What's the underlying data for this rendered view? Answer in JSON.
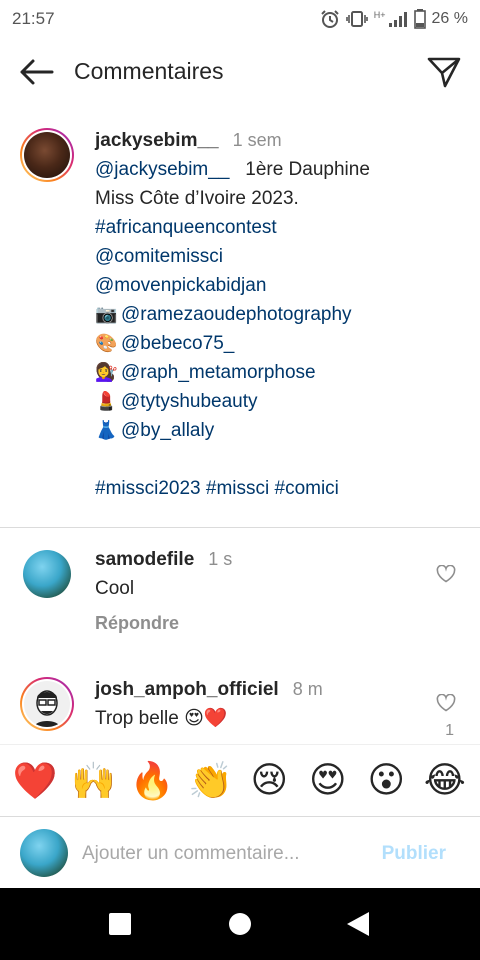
{
  "status": {
    "time": "21:57",
    "net_label": "H+",
    "battery": "26 %",
    "icons": [
      "alarm-icon",
      "vibrate-icon",
      "signal-icon",
      "battery-icon"
    ]
  },
  "header": {
    "title": "Commentaires",
    "back_icon": "arrow-left-icon",
    "share_icon": "send-icon"
  },
  "caption": {
    "username": "jackysebim__",
    "time": "1 sem",
    "mention_self": "@jackysebim__",
    "line1_rest": "1ère Dauphine",
    "line2": "Miss Côte d’Ivoire 2023.",
    "hashtag1": "#africanqueencontest",
    "mention1": "@comitemissci",
    "mention2": "@movenpickabidjan",
    "credits": [
      {
        "emoji": "📷",
        "handle": "@ramezaoudephotography"
      },
      {
        "emoji": "🎨",
        "handle": "@bebeco75_"
      },
      {
        "emoji": "💇‍♀️",
        "handle": "@raph_metamorphose"
      },
      {
        "emoji": "💄",
        "handle": "@tytyshubeauty"
      },
      {
        "emoji": "👗",
        "handle": "@by_allaly"
      }
    ],
    "hashtags": "#missci2023 #missci #comici"
  },
  "comments": [
    {
      "username": "samodefile",
      "time": "1 s",
      "text": "Cool",
      "reply": "Répondre",
      "likes": ""
    },
    {
      "username": "josh_ampoh_officiel",
      "time": "8 m",
      "text": "Trop belle 😍❤️",
      "reply": "",
      "likes": "1"
    }
  ],
  "emoji_bar": [
    "❤️",
    "🙌",
    "🔥",
    "👏",
    "😢",
    "😍",
    "😮",
    "😂"
  ],
  "input": {
    "placeholder": "Ajouter un commentaire...",
    "publish": "Publier"
  },
  "colors": {
    "link": "#00376b",
    "muted": "#8e8e8e",
    "publish": "#b2dffc",
    "text": "#262626"
  }
}
